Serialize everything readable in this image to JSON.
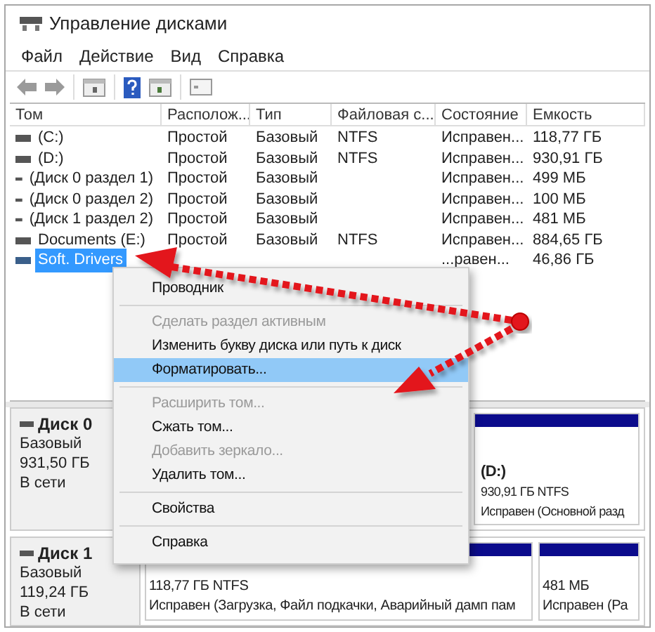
{
  "window": {
    "title": "Управление дисками"
  },
  "menu": [
    "Файл",
    "Действие",
    "Вид",
    "Справка"
  ],
  "volumes": {
    "columns": [
      "Том",
      "Располож...",
      "Тип",
      "Файловая с...",
      "Состояние",
      "Емкость"
    ],
    "rows": [
      {
        "cells": [
          "(C:)",
          "Простой",
          "Базовый",
          "NTFS",
          "Исправен...",
          "118,77 ГБ"
        ],
        "selected": false
      },
      {
        "cells": [
          "(D:)",
          "Простой",
          "Базовый",
          "NTFS",
          "Исправен...",
          "930,91 ГБ"
        ],
        "selected": false
      },
      {
        "cells": [
          "(Диск 0 раздел 1)",
          "Простой",
          "Базовый",
          "",
          "Исправен...",
          "499 МБ"
        ],
        "selected": false
      },
      {
        "cells": [
          "(Диск 0 раздел 2)",
          "Простой",
          "Базовый",
          "",
          "Исправен...",
          "100 МБ"
        ],
        "selected": false
      },
      {
        "cells": [
          "(Диск 1 раздел 2)",
          "Простой",
          "Базовый",
          "",
          "Исправен...",
          "481 МБ"
        ],
        "selected": false
      },
      {
        "cells": [
          "Documents (E:)",
          "Простой",
          "Базовый",
          "NTFS",
          "Исправен...",
          "884,65 ГБ"
        ],
        "selected": false
      },
      {
        "cells": [
          "Soft. Drivers",
          "",
          "",
          "",
          "...равен...",
          "46,86 ГБ"
        ],
        "selected": true
      }
    ]
  },
  "disks": [
    {
      "name": "Диск 0",
      "type": "Базовый",
      "size": "931,50 ГБ",
      "status": "В сети",
      "partitions": [
        {
          "label": "(D:)",
          "detail": "930,91 ГБ NTFS",
          "status": "Исправен (Основной разд"
        }
      ]
    },
    {
      "name": "Диск 1",
      "type": "Базовый",
      "size": "119,24 ГБ",
      "status": "В сети",
      "partitions": [
        {
          "detail": "118,77 ГБ NTFS",
          "status": "Исправен (Загрузка, Файл подкачки, Аварийный дамп пам"
        },
        {
          "detail": "481 МБ",
          "status": "Исправен (Ра"
        }
      ]
    }
  ],
  "context_menu": [
    {
      "kind": "item",
      "label": "Проводник",
      "disabled": false,
      "selected": false
    },
    {
      "kind": "separator"
    },
    {
      "kind": "item",
      "label": "Сделать раздел активным",
      "disabled": true,
      "selected": false
    },
    {
      "kind": "item",
      "label": "Изменить букву диска или путь к диск",
      "disabled": false,
      "selected": false
    },
    {
      "kind": "item",
      "label": "Форматировать...",
      "disabled": false,
      "selected": true
    },
    {
      "kind": "separator"
    },
    {
      "kind": "item",
      "label": "Расширить том...",
      "disabled": true,
      "selected": false
    },
    {
      "kind": "item",
      "label": "Сжать том...",
      "disabled": false,
      "selected": false
    },
    {
      "kind": "item",
      "label": "Добавить зеркало...",
      "disabled": true,
      "selected": false
    },
    {
      "kind": "item",
      "label": "Удалить том...",
      "disabled": false,
      "selected": false
    },
    {
      "kind": "separator"
    },
    {
      "kind": "item",
      "label": "Свойства",
      "disabled": false,
      "selected": false
    },
    {
      "kind": "separator"
    },
    {
      "kind": "item",
      "label": "Справка",
      "disabled": false,
      "selected": false
    }
  ]
}
